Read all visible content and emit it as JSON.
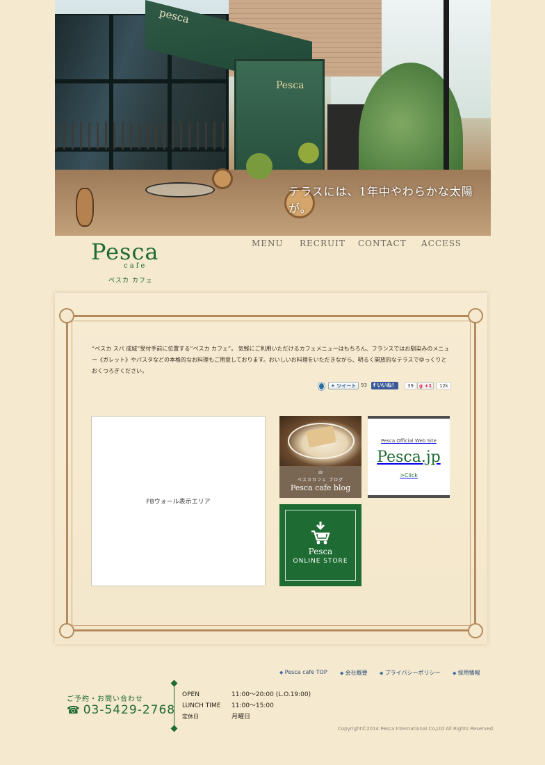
{
  "hero": {
    "awning_text": "pesca",
    "door_sign": "Pesca",
    "caption": "テラスには、1年中やわらかな太陽が。"
  },
  "logo": {
    "main": "Pesca",
    "sub": "cafe",
    "kana": "ペスカ カフェ"
  },
  "nav": {
    "items": [
      "MENU",
      "RECRUIT",
      "CONTACT",
      "ACCESS"
    ]
  },
  "intro": {
    "text": "“ペスカ スパ 成城”受付手前に位置する“ペスカ カフェ”。 気軽にご利用いただけるカフェメニューはもちろん、フランスではお馴染みのメニュー《ガレット》やパスタなどの本格的なお料理もご用意しております。おいしいお料理をいただきながら、明るく開放的なテラスでゆっくりとおくつろぎください。"
  },
  "social": {
    "tweet_label": "ツイート",
    "tweet_count": "93",
    "like_label": "いいね！",
    "like_count": "39",
    "plusone_label": "+1",
    "plusone_count": "12k"
  },
  "fb_wall": {
    "label": "FBウォール表示エリア"
  },
  "blog": {
    "jp": "ペスカカフェ ブログ",
    "en": "Pesca cafe blog"
  },
  "official": {
    "small": "Pesca Official Web Site",
    "big": "Pesca.jp",
    "click": ">Click"
  },
  "store": {
    "name": "Pesca",
    "sub": "ONLINE STORE"
  },
  "footer": {
    "links": [
      "Pesca cafe TOP",
      "会社概要",
      "プライバシーポリシー",
      "採用情報"
    ],
    "contact_label": "ご予約・お問い合わせ",
    "phone": "03-5429-2768",
    "hours": [
      {
        "key": "OPEN",
        "value": "11:00〜20:00 (L.O.19:00)"
      },
      {
        "key": "LUNCH TIME",
        "value": "11:00〜15:00"
      },
      {
        "key": "定休日",
        "value": "月曜日"
      }
    ],
    "copyright": "Copyright©2014   Pesca International Co,Ltd All Rights Reserved."
  },
  "colors": {
    "brand_green": "#1f6a35",
    "background": "#f5e9cf",
    "frame_brown": "#b48a5c",
    "link_blue": "#2d4d78"
  }
}
